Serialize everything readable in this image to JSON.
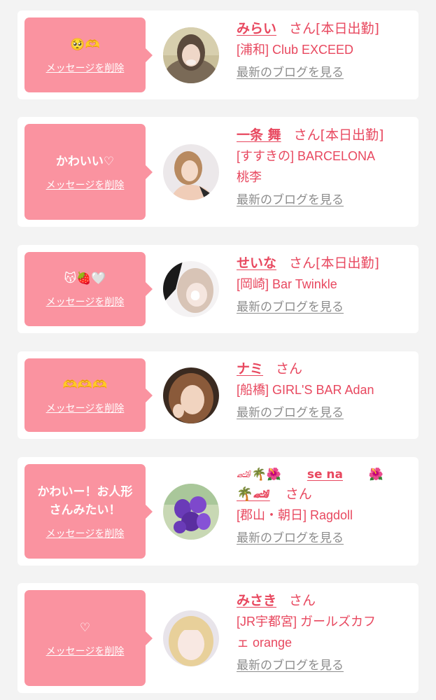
{
  "delete_label": "メッセージを削除",
  "blog_label": "最新のブログを見る",
  "accent_color": "#e8485f",
  "bubble_color": "#fa93a0",
  "cards": [
    {
      "message": "🥺🫶",
      "name": "みらい",
      "suffix": "さん",
      "status": "[本日出勤]",
      "shop_line1": "[浦和] Club EXCEED",
      "shop_line2": ""
    },
    {
      "message": "かわいい♡",
      "name": "一条 舞",
      "suffix": "さん",
      "status": "[本日出勤]",
      "shop_line1": "[すすきの] BARCELONA",
      "shop_line2": "桃李"
    },
    {
      "message": "😽🍓🤍",
      "name": "せいな",
      "suffix": "さん",
      "status": "[本日出勤]",
      "shop_line1": "[岡崎] Bar Twinkle",
      "shop_line2": ""
    },
    {
      "message": "🫶🫶🫶",
      "name": "ナミ",
      "suffix": "さん",
      "status": "",
      "shop_line1": "[船橋] GIRL'S BAR Adan",
      "shop_line2": ""
    },
    {
      "message": "かわいー！お人形\nさんみたい！",
      "name": "se na",
      "name_prefix": "🏎🌴🌺",
      "name_suffix": "🌺",
      "name_line2": "🌴🏎",
      "suffix": "さん",
      "status": "",
      "shop_line1": "[郡山・朝日] Ragdoll",
      "shop_line2": ""
    },
    {
      "message": "♡",
      "name": "みさき",
      "suffix": "さん",
      "status": "",
      "shop_line1": "[JR宇都宮] ガールズカフ",
      "shop_line2": "ェ orange"
    }
  ]
}
